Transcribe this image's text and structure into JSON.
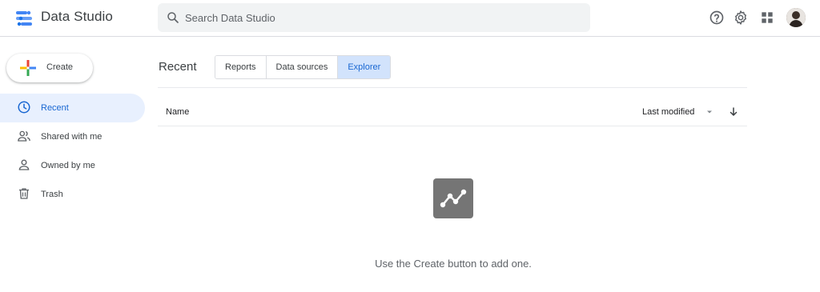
{
  "app": {
    "title": "Data Studio"
  },
  "search": {
    "placeholder": "Search Data Studio"
  },
  "header_icons": [
    "help-icon",
    "settings-icon",
    "apps-grid-icon",
    "avatar"
  ],
  "sidebar": {
    "create_label": "Create",
    "items": [
      {
        "label": "Recent",
        "icon": "clock-icon",
        "active": true
      },
      {
        "label": "Shared with me",
        "icon": "people-icon",
        "active": false
      },
      {
        "label": "Owned by me",
        "icon": "person-icon",
        "active": false
      },
      {
        "label": "Trash",
        "icon": "trash-icon",
        "active": false
      }
    ]
  },
  "main": {
    "title": "Recent",
    "tabs": [
      {
        "label": "Reports",
        "active": false
      },
      {
        "label": "Data sources",
        "active": false
      },
      {
        "label": "Explorer",
        "active": true
      }
    ],
    "columns": {
      "name": "Name",
      "modified": "Last modified"
    },
    "empty_message": "Use the Create button to add one."
  },
  "colors": {
    "accent": "#1967d2",
    "active_bg": "#e8f0fe",
    "active_tab_bg": "#d2e3fc"
  }
}
